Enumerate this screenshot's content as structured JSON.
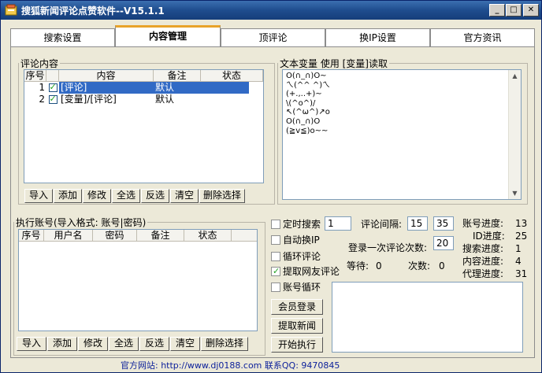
{
  "window": {
    "title": "搜狐新闻评论点赞软件--V15.1.1",
    "min": "_",
    "max": "□",
    "close": "✕"
  },
  "tabs": [
    "搜索设置",
    "内容管理",
    "顶评论",
    "换IP设置",
    "官方资讯"
  ],
  "active_tab": "内容管理",
  "comments": {
    "legend": "评论内容",
    "columns": [
      "序号",
      "",
      "内容",
      "备注",
      "状态"
    ],
    "rows": [
      {
        "no": "1",
        "checked": true,
        "content": "[评论]",
        "note": "默认",
        "status": ""
      },
      {
        "no": "2",
        "checked": true,
        "content": "[变量]/[评论]",
        "note": "默认",
        "status": ""
      }
    ],
    "buttons": [
      "导入",
      "添加",
      "修改",
      "全选",
      "反选",
      "清空",
      "删除选择"
    ]
  },
  "variables": {
    "legend": "文本变量 使用 [变量]读取",
    "text": "O(∩_∩)O~\nㄟ(^^ ^)ㄟ\n(+.,..+)~\n\\(^o^)/\n↖(^ω^)↗o\nO(∩_∩)O\n(≧v≦)o~~"
  },
  "accounts": {
    "legend": "执行账号(导入格式: 账号|密码)",
    "columns": [
      "序号",
      "用户名",
      "密码",
      "备注",
      "状态"
    ],
    "buttons": [
      "导入",
      "添加",
      "修改",
      "全选",
      "反选",
      "清空",
      "删除选择"
    ]
  },
  "options": {
    "timed_search": {
      "label": "定时搜索",
      "checked": false,
      "value": "1"
    },
    "auto_ip": {
      "label": "自动换IP",
      "checked": false
    },
    "loop_comment": {
      "label": "循环评论",
      "checked": false
    },
    "fetch_user_comment": {
      "label": "提取网友评论",
      "checked": true
    },
    "account_loop": {
      "label": "账号循环",
      "checked": false
    },
    "interval_label": "评论间隔:",
    "interval_min": "15",
    "interval_max": "35",
    "per_login_label": "登录一次评论次数:",
    "per_login_value": "20",
    "wait_label": "等待:",
    "wait_value": "0",
    "count_label": "次数:",
    "count_value": "0"
  },
  "progress": [
    {
      "label": "账号进度:",
      "value": "13"
    },
    {
      "label": "ID进度:",
      "value": "25"
    },
    {
      "label": "搜索进度:",
      "value": "1"
    },
    {
      "label": "内容进度:",
      "value": "4"
    },
    {
      "label": "代理进度:",
      "value": "31"
    }
  ],
  "actions": {
    "member_login": "会员登录",
    "fetch_news": "提取新闻",
    "start": "开始执行"
  },
  "status": "官方网站: http://www.dj0188.com  联系QQ: 9470845",
  "colors": {
    "title_bar": "#1f4d8e",
    "selection": "#316ac5",
    "tab_accent": "#e8a32a",
    "status_text": "#0b1f9a"
  }
}
